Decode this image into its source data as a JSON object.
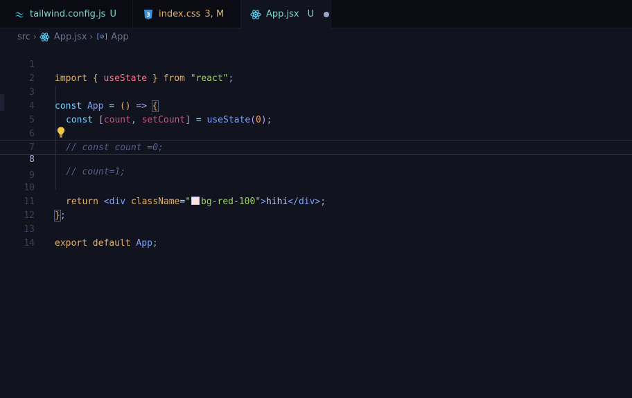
{
  "tabs": [
    {
      "name": "tailwind.config.js",
      "status": "U",
      "name_color": "#73daca",
      "status_color": "#73daca",
      "icon": "tailwind-icon",
      "active": false
    },
    {
      "name": "index.css",
      "status": "3, M",
      "name_color": "#e0af68",
      "status_color": "#e0af68",
      "icon": "css3-icon",
      "active": false
    },
    {
      "name": "App.jsx",
      "status": "U",
      "name_color": "#73daca",
      "status_color": "#73daca",
      "icon": "react-icon",
      "active": true,
      "unsaved": true
    }
  ],
  "breadcrumb": {
    "folder": "src",
    "file": "App.jsx",
    "symbol": "App"
  },
  "editor": {
    "line_numbers": [
      "1",
      "2",
      "3",
      "4",
      "5",
      "6",
      "7",
      "8",
      "9",
      "10",
      "11",
      "12",
      "13",
      "14"
    ],
    "current_line": 8,
    "code": {
      "l1": {
        "import": "import",
        "open": "{",
        "name": "useState",
        "close": "}",
        "from": "from",
        "module": "\"react\"",
        "semi": ";"
      },
      "l3": {
        "const": "const",
        "name": "App",
        "eq": "=",
        "parens": "()",
        "arrow": "=>",
        "brace": "{"
      },
      "l4": {
        "const": "const",
        "lb": "[",
        "count": "count",
        "comma": ",",
        "setter": "setCount",
        "rb": "]",
        "eq": "=",
        "fn": "useState",
        "lp": "(",
        "arg": "0",
        "rp": ")",
        "semi": ";"
      },
      "l6": {
        "comment": "// const count =0;"
      },
      "l8": {
        "comment": "// count=1;"
      },
      "l10": {
        "return": "return",
        "open_tag": "<div",
        "attr": "className",
        "eq": "=",
        "q1": "\"",
        "value": "bg-red-100",
        "q2": "\"",
        "gt": ">",
        "text": "hihi",
        "close_tag": "</div>",
        "semi": ";"
      },
      "l11": {
        "brace": "}",
        "semi": ";"
      },
      "l13": {
        "export": "export",
        "default": "default",
        "name": "App",
        "semi": ";"
      }
    },
    "color_swatch": "#fee2e2"
  }
}
